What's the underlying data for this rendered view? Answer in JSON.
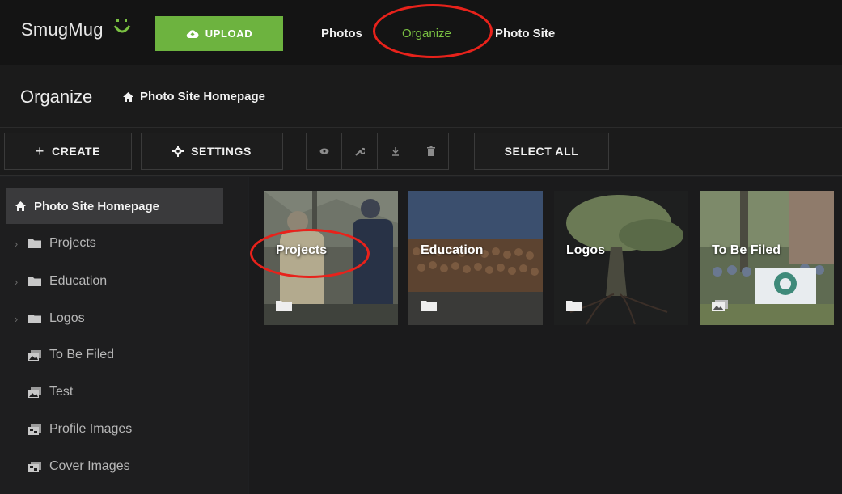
{
  "brand": {
    "name": "SmugMug",
    "accent": "#6db33f",
    "annotation_color": "#e8221b"
  },
  "topnav": {
    "upload_label": "UPLOAD",
    "links": [
      "Photos",
      "Organize",
      "Photo Site"
    ]
  },
  "header": {
    "title": "Organize",
    "breadcrumb": "Photo Site Homepage"
  },
  "toolbar": {
    "create_label": "CREATE",
    "settings_label": "SETTINGS",
    "select_all_label": "SELECT ALL",
    "icons": [
      "eye-icon",
      "wrench-icon",
      "download-icon",
      "trash-icon"
    ]
  },
  "sidebar": {
    "items": [
      {
        "label": "Photo Site Homepage",
        "icon": "home-icon",
        "selected": true
      },
      {
        "label": "Projects",
        "icon": "folder-icon",
        "expandable": true
      },
      {
        "label": "Education",
        "icon": "folder-icon",
        "expandable": true
      },
      {
        "label": "Logos",
        "icon": "folder-icon",
        "expandable": true
      },
      {
        "label": "To Be Filed",
        "icon": "gallery-icon"
      },
      {
        "label": "Test",
        "icon": "gallery-icon"
      },
      {
        "label": "Profile Images",
        "icon": "gallery-locked-icon"
      },
      {
        "label": "Cover Images",
        "icon": "gallery-locked-icon"
      }
    ]
  },
  "tiles": [
    {
      "label": "Projects",
      "icon": "folder-icon"
    },
    {
      "label": "Education",
      "icon": "folder-icon"
    },
    {
      "label": "Logos",
      "icon": "folder-icon"
    },
    {
      "label": "To Be Filed",
      "icon": "gallery-icon"
    }
  ]
}
